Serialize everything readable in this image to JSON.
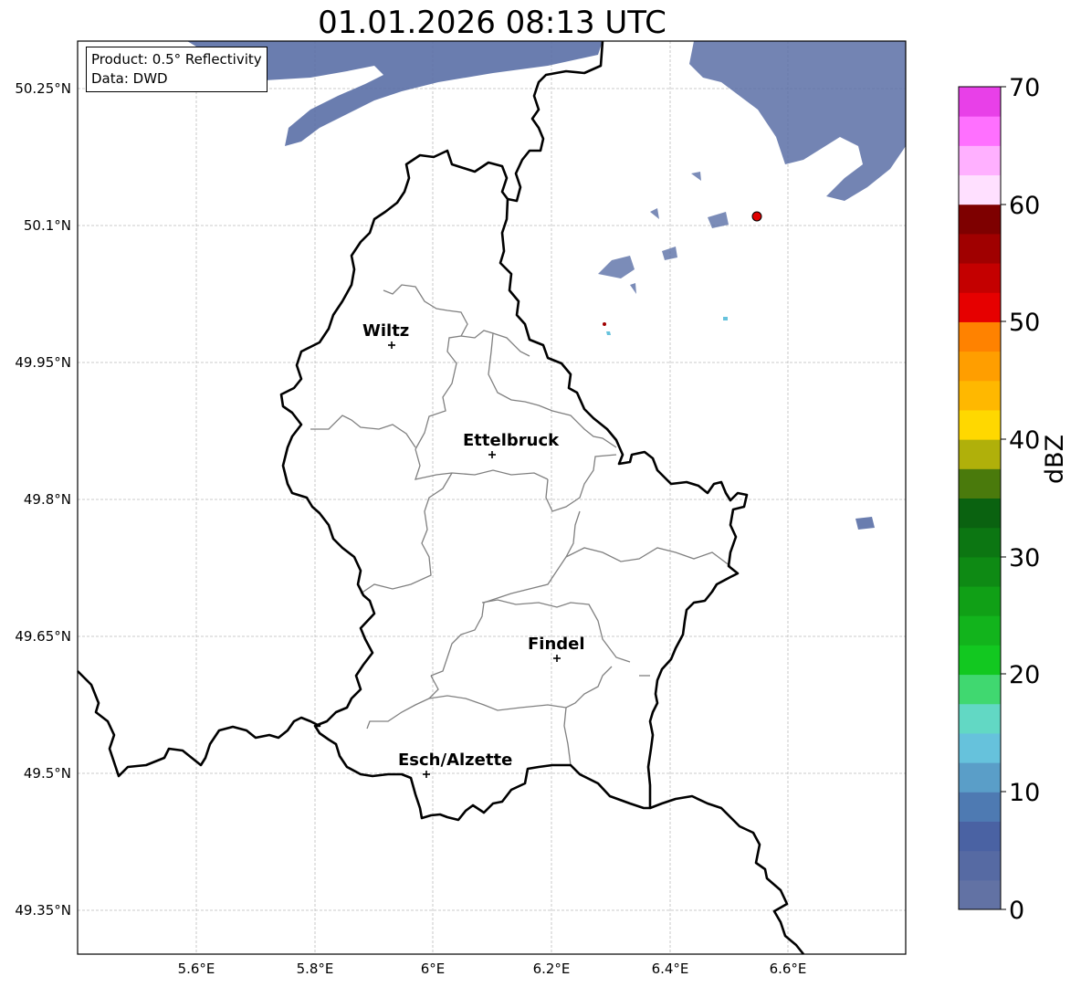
{
  "title": "01.01.2026 08:13 UTC",
  "info": {
    "product": "Product: 0.5° Reflectivity",
    "data": "Data: DWD"
  },
  "axes": {
    "lat_labels": [
      "50.25°N",
      "50.1°N",
      "49.95°N",
      "49.8°N",
      "49.65°N",
      "49.5°N",
      "49.35°N"
    ],
    "lon_labels": [
      "5.6°E",
      "5.8°E",
      "6°E",
      "6.2°E",
      "6.4°E",
      "6.6°E"
    ]
  },
  "cities": [
    {
      "name": "Wiltz"
    },
    {
      "name": "Ettelbruck"
    },
    {
      "name": "Findel"
    },
    {
      "name": "Esch/Alzette"
    }
  ],
  "colorbar": {
    "title": "dBZ",
    "tick_labels": [
      "70",
      "60",
      "50",
      "40",
      "30",
      "20",
      "10",
      "0"
    ],
    "min": 0,
    "max": 70,
    "step": 2.5,
    "colors": [
      "#6272a4",
      "#566aa3",
      "#4a62a3",
      "#4e7ab2",
      "#5a9ec8",
      "#66c2dc",
      "#62d8c4",
      "#40d870",
      "#12c820",
      "#12b41c",
      "#10a016",
      "#0e8a14",
      "#0c7612",
      "#0a6210",
      "#4a7a0c",
      "#b0b00a",
      "#ffd800",
      "#ffb800",
      "#ff9e00",
      "#ff8200",
      "#e60000",
      "#c40000",
      "#a00000",
      "#7e0000",
      "#ffe0ff",
      "#ffb0ff",
      "#ff70ff",
      "#e840e8"
    ]
  },
  "colors": {
    "radar_echo": "#5a6fa6",
    "station_marker": "#e00000"
  }
}
